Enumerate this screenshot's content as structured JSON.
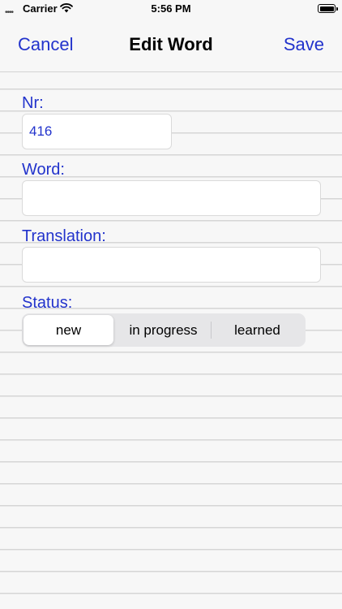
{
  "status_bar": {
    "carrier": "Carrier",
    "time": "5:56 PM",
    "signal": "••••"
  },
  "nav": {
    "cancel_label": "Cancel",
    "title": "Edit Word",
    "save_label": "Save"
  },
  "form": {
    "nr_label": "Nr:",
    "nr_value": "416",
    "word_label": "Word:",
    "word_value": "",
    "translation_label": "Translation:",
    "translation_value": "",
    "status_label": "Status:"
  },
  "status_options": {
    "new": "new",
    "in_progress": "in progress",
    "learned": "learned",
    "selected": "new"
  },
  "colors": {
    "accent": "#2233cc",
    "background": "#f7f7f7",
    "ruled_line": "#d6d6d6"
  },
  "icons": [
    "signal-icon",
    "wifi-icon",
    "battery-icon"
  ]
}
